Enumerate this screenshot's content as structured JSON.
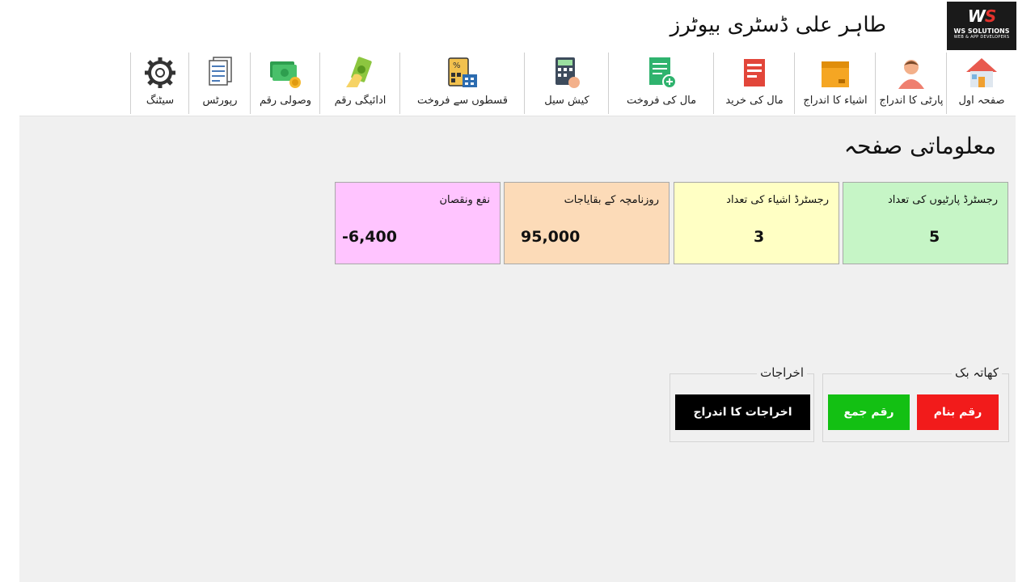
{
  "app": {
    "title": "طاہر علی ڈسٹری بیوٹرز"
  },
  "logo": {
    "mark_w": "W",
    "mark_s": "S",
    "name": "WS SOLUTIONS",
    "tagline": "WEB & APP DEVELOPERS"
  },
  "toolbar": [
    {
      "id": "home",
      "label": "صفحہ اول",
      "icon": "house-icon"
    },
    {
      "id": "party",
      "label": "پارٹی کا اندراج",
      "icon": "person-icon"
    },
    {
      "id": "items",
      "label": "اشیاء کا اندراج",
      "icon": "box-icon"
    },
    {
      "id": "purchase",
      "label": "مال کی خرید",
      "icon": "receipt-icon"
    },
    {
      "id": "sale",
      "label": "مال کی فروخت",
      "icon": "add-document-icon"
    },
    {
      "id": "cash-sale",
      "label": "کیش سیل",
      "icon": "calculator-icon"
    },
    {
      "id": "installment",
      "label": "قسطوں سے فروخت",
      "icon": "installment-calculator-icon"
    },
    {
      "id": "payment",
      "label": "ادائیگی رقم",
      "icon": "money-hand-icon"
    },
    {
      "id": "receipt",
      "label": "وصولی رقم",
      "icon": "cash-coins-icon"
    },
    {
      "id": "reports",
      "label": "رپورٹس",
      "icon": "documents-icon"
    },
    {
      "id": "settings",
      "label": "سیٹنگ",
      "icon": "gear-icon"
    }
  ],
  "page": {
    "heading": "معلوماتی صفحہ"
  },
  "cards": [
    {
      "title": "رجسٹرڈ پارٹیوں کی تعداد",
      "value": "5",
      "color": "#c6f5c6"
    },
    {
      "title": "رجسٹرڈ اشیاء کی تعداد",
      "value": "3",
      "color": "#ffffc4"
    },
    {
      "title": "روزنامچہ کے بقایاجات",
      "value": "95,000",
      "color": "#fcdbb8"
    },
    {
      "title": "نفع ونقصان",
      "value": "-6,400",
      "color": "#ffc4ff"
    }
  ],
  "khata": {
    "title": "کھاتہ بک",
    "debit_label": "رقم بنام",
    "credit_label": "رقم جمع",
    "debit_color": "#f21b1b",
    "credit_color": "#13c013"
  },
  "expenses": {
    "title": "اخراجات",
    "entry_label": "اخراجات کا اندراج",
    "color": "#000000"
  }
}
